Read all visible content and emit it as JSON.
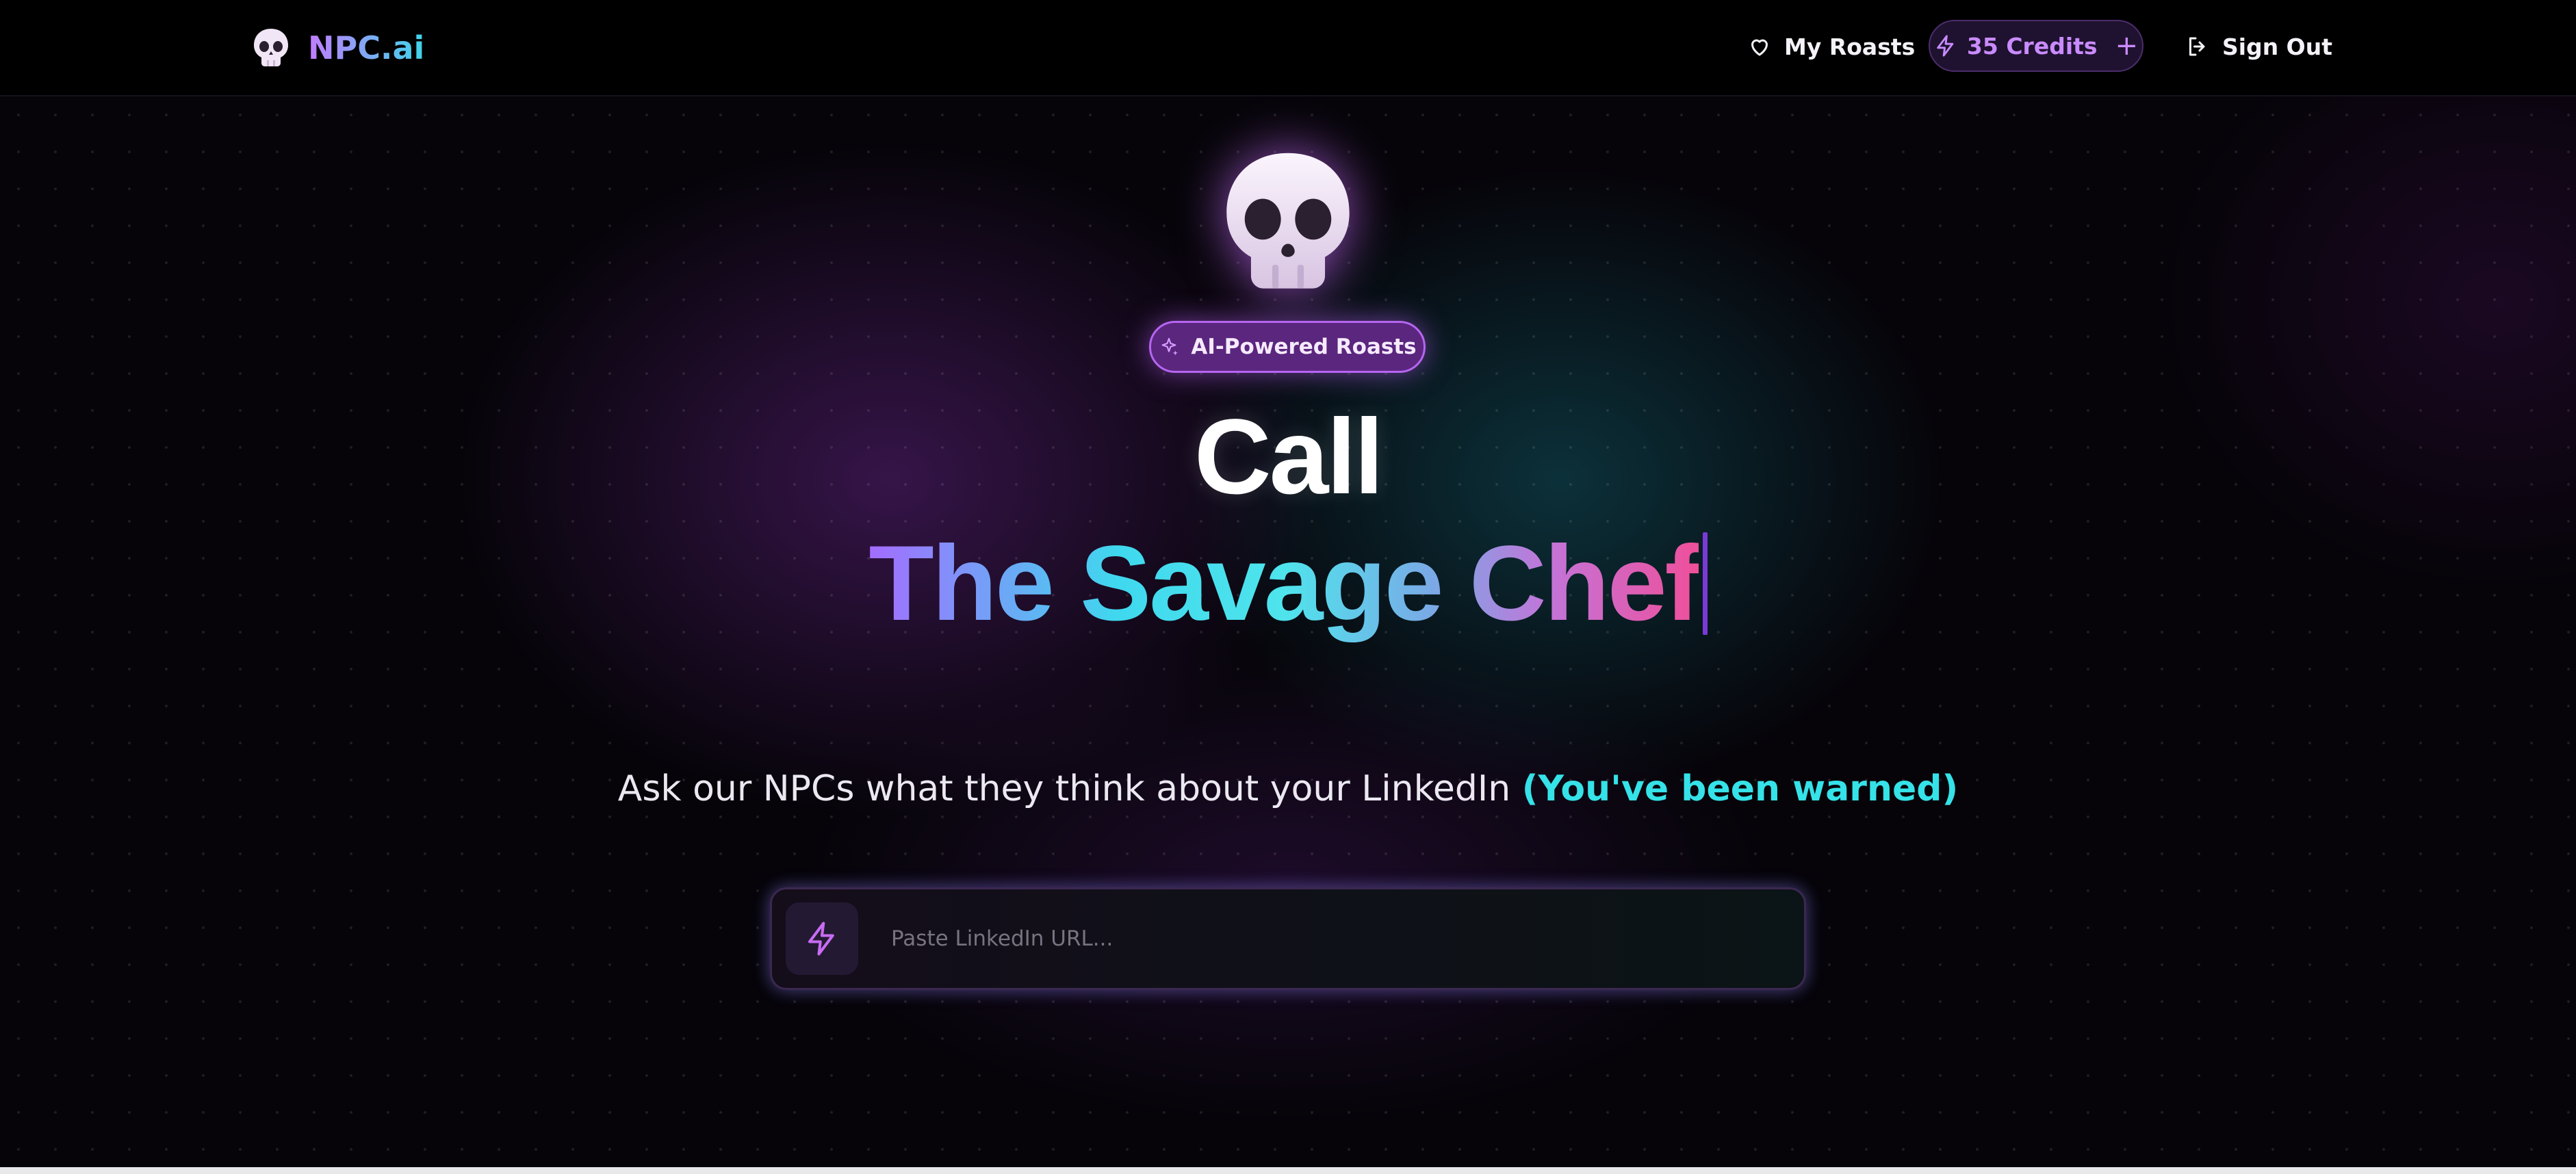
{
  "header": {
    "brand_name": "NPC.ai",
    "nav": {
      "my_roasts_label": "My Roasts",
      "credits_label": "35 Credits",
      "add_credits_symbol": "+",
      "sign_out_label": "Sign Out"
    },
    "icons": [
      "skull-logo-icon",
      "heart-icon",
      "lightning-icon",
      "plus-icon",
      "sign-out-icon"
    ]
  },
  "hero": {
    "badge_label": "AI-Powered Roasts",
    "headline_line1": "Call",
    "headline_line2": "The Savage Chef",
    "subtitle": "Ask our NPCs what they think about your LinkedIn",
    "subtitle_highlight": "(You've been warned)",
    "url_input": {
      "value": "",
      "placeholder": "Paste LinkedIn URL..."
    },
    "icons": [
      "skull-icon",
      "sparkle-icon",
      "lightning-icon"
    ]
  },
  "colors": {
    "brand_gradient_start": "#c27cff",
    "brand_gradient_end": "#3fd5ea",
    "credits_accent": "#c98bff",
    "highlight_cyan": "#35e2e8",
    "badge_background": "#5b267e",
    "page_background": "#060409"
  }
}
